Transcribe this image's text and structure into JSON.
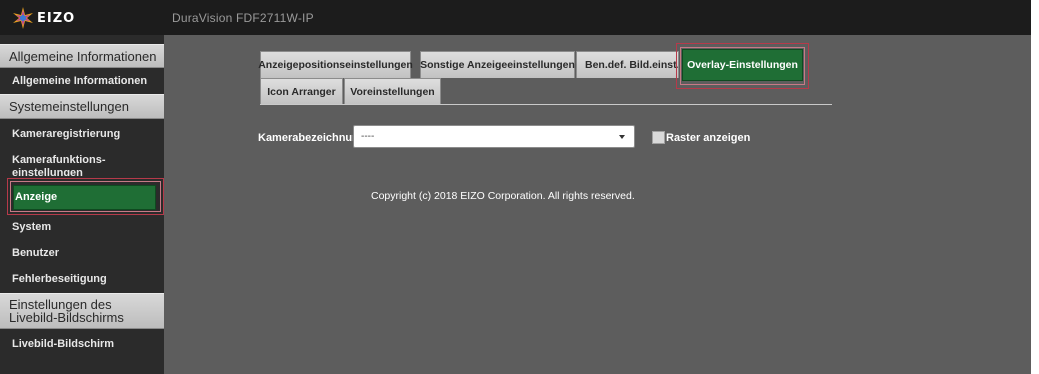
{
  "header": {
    "brand": "EIZO",
    "model": "DuraVision FDF2711W-IP"
  },
  "sidebar": {
    "sections": [
      {
        "title": "Allgemeine Informationen",
        "items": [
          "Allgemeine Informationen"
        ]
      },
      {
        "title": "Systemeinstellungen",
        "items": [
          "Kameraregistrierung",
          "Kamerafunktions-einstellungen",
          "Anzeige",
          "System",
          "Benutzer",
          "Fehlerbeseitigung"
        ]
      },
      {
        "title": "Einstellungen des Livebild-Bildschirms",
        "items": [
          "Livebild-Bildschirm"
        ]
      }
    ],
    "active_item": "Anzeige"
  },
  "tabs": {
    "row1": [
      "Anzeigepositionseinstellungen",
      "Sonstige Anzeigeeinstellungen",
      "Ben.def. Bild.einst.",
      "Overlay-Einstellungen"
    ],
    "row2": [
      "Icon Arranger",
      "Voreinstellungen"
    ],
    "active_tab": "Overlay-Einstellungen"
  },
  "form": {
    "camera_label": "Kamerabezeichnung",
    "camera_value": "----",
    "raster_label": "Raster anzeigen",
    "raster_checked": false
  },
  "footer": {
    "copyright": "Copyright (c) 2018 EIZO Corporation. All rights reserved."
  },
  "colors": {
    "active_green": "#1f6e35",
    "topbar": "#1c1c1c",
    "content_bg": "#5d5d5d",
    "sidebar_bg": "#2b2b2b",
    "highlight": "#b63a4a"
  },
  "icons": {
    "logo": "eizo-star-logo-icon",
    "dropdown": "caret-down-icon",
    "checkbox": "checkbox-icon"
  }
}
